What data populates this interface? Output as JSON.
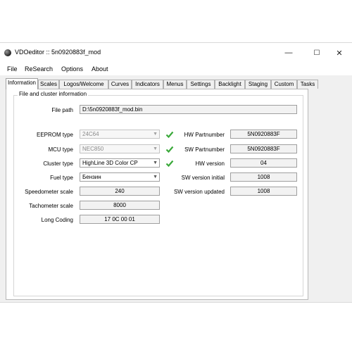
{
  "window": {
    "title": "VDOeditor :: 5n0920883f_mod",
    "controls": {
      "minimize": "—",
      "maximize": "☐",
      "close": "✕"
    }
  },
  "menu": [
    "File",
    "ReSearch",
    "Options",
    "About"
  ],
  "tabs": [
    "Information",
    "Scales",
    "Logos/Welcome",
    "Curves",
    "Indicators",
    "Menus",
    "Settings",
    "Backlight",
    "Staging",
    "Custom",
    "Tasks"
  ],
  "active_tab": "Information",
  "group": {
    "title": "File and cluster information"
  },
  "file_path": {
    "label": "File path",
    "value": "D:\\5n0920883f_mod.bin"
  },
  "left_fields": {
    "eeprom": {
      "label": "EEPROM type",
      "value": "24C64"
    },
    "mcu": {
      "label": "MCU type",
      "value": "NEC850"
    },
    "cluster": {
      "label": "Cluster type",
      "value": "HighLine 3D Color CP"
    },
    "fuel": {
      "label": "Fuel type",
      "value": "Бензин"
    },
    "speedo": {
      "label": "Speedometer scale",
      "value": "240"
    },
    "tacho": {
      "label": "Tachometer scale",
      "value": "8000"
    },
    "coding": {
      "label": "Long Coding",
      "value": "17 0C 00 01"
    }
  },
  "right_fields": {
    "hw_part": {
      "label": "HW Partnumber",
      "value": "5N0920883F"
    },
    "sw_part": {
      "label": "SW Partnumber",
      "value": "5N0920883F"
    },
    "hw_ver": {
      "label": "HW version",
      "value": "04"
    },
    "sw_init": {
      "label": "SW version initial",
      "value": "1008"
    },
    "sw_upd": {
      "label": "SW version updated",
      "value": "1008"
    }
  },
  "colors": {
    "check": "#3aa93a",
    "window_bg": "#f0f0f0"
  },
  "icons": {
    "check": "checkmark-icon",
    "arrow": "chevron-down-icon",
    "app": "app-icon"
  }
}
